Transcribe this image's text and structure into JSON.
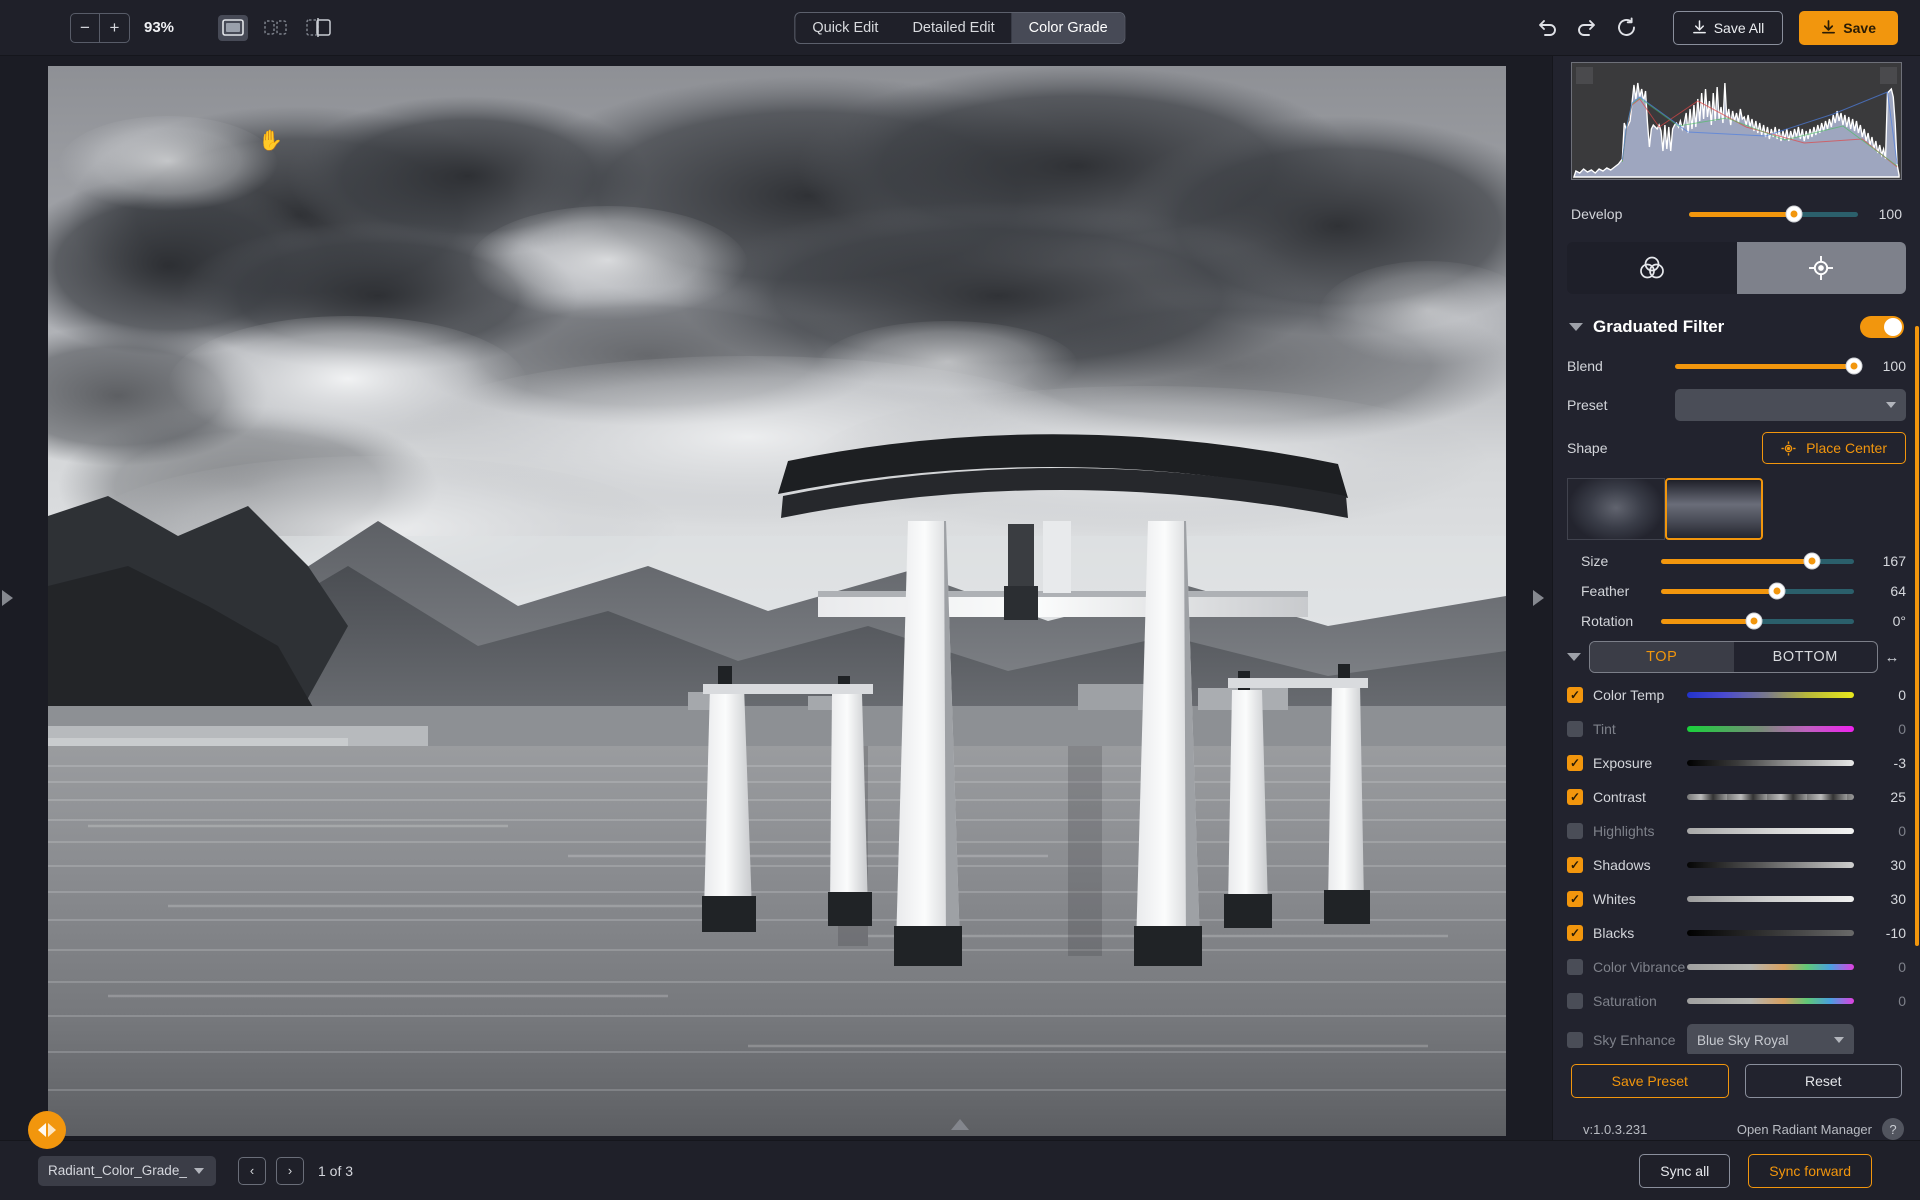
{
  "toolbar": {
    "zoom_out": "−",
    "zoom_in": "+",
    "zoom_level": "93%",
    "view_modes": [
      {
        "name": "single-view-icon",
        "active": true
      },
      {
        "name": "split-view-icon",
        "active": false
      },
      {
        "name": "compare-view-icon",
        "active": false
      }
    ],
    "tabs": [
      {
        "label": "Quick Edit",
        "active": false
      },
      {
        "label": "Detailed Edit",
        "active": false
      },
      {
        "label": "Color Grade",
        "active": true
      }
    ],
    "undo_label": "Undo",
    "redo_label": "Redo",
    "reset_label": "Reset",
    "save_all_label": "Save All",
    "save_label": "Save"
  },
  "panel": {
    "develop": {
      "label": "Develop",
      "value": "100",
      "percent": 62
    },
    "tool_tabs": [
      {
        "name": "color-wheels-icon",
        "active": false
      },
      {
        "name": "target-adjust-icon",
        "active": true
      }
    ],
    "section": {
      "title": "Graduated Filter",
      "enabled": true
    },
    "blend": {
      "label": "Blend",
      "value": "100",
      "percent": 100
    },
    "preset": {
      "label": "Preset",
      "value": "",
      "placeholder": ""
    },
    "shape": {
      "label": "Shape",
      "button": "Place Center"
    },
    "shape_tiles": [
      {
        "name": "radial-shape-tile",
        "selected": false
      },
      {
        "name": "graduated-shape-tile",
        "selected": true
      }
    ],
    "geometry": [
      {
        "label": "Size",
        "value": "167",
        "percent": 78
      },
      {
        "label": "Feather",
        "value": "64",
        "percent": 60
      },
      {
        "label": "Rotation",
        "value": "0°",
        "percent": 48
      }
    ],
    "top_bottom": {
      "top": "TOP",
      "bottom": "BOTTOM",
      "active": "TOP"
    },
    "adjustments": [
      {
        "label": "Color Temp",
        "checked": true,
        "value": "0",
        "percent": 50,
        "grad": "temp"
      },
      {
        "label": "Tint",
        "checked": false,
        "value": "0",
        "percent": 50,
        "grad": "tint",
        "hide_knob": true
      },
      {
        "label": "Exposure",
        "checked": true,
        "value": "-3",
        "percent": 47,
        "grad": "gray"
      },
      {
        "label": "Contrast",
        "checked": true,
        "value": "25",
        "percent": 60,
        "grad": "contrast"
      },
      {
        "label": "Highlights",
        "checked": false,
        "value": "0",
        "percent": 50,
        "grad": "light",
        "hide_knob": true
      },
      {
        "label": "Shadows",
        "checked": true,
        "value": "30",
        "percent": 62,
        "grad": "gray"
      },
      {
        "label": "Whites",
        "checked": true,
        "value": "30",
        "percent": 62,
        "grad": "light"
      },
      {
        "label": "Blacks",
        "checked": true,
        "value": "-10",
        "percent": 45,
        "grad": "dark"
      },
      {
        "label": "Color Vibrance",
        "checked": false,
        "value": "0",
        "percent": 50,
        "grad": "vibrance",
        "hide_knob": true
      },
      {
        "label": "Saturation",
        "checked": false,
        "value": "0",
        "percent": 50,
        "grad": "vibrance",
        "hide_knob": true
      }
    ],
    "sky_enhance": {
      "label": "Sky Enhance",
      "checked": false,
      "value": "Blue Sky Royal"
    },
    "save_preset_label": "Save Preset",
    "reset_label": "Reset",
    "version": "v:1.0.3.231",
    "manager_label": "Open Radiant Manager",
    "help_label": "?"
  },
  "bottombar": {
    "file_name": "Radiant_Color_Grade_",
    "prev_label": "‹",
    "next_label": "›",
    "counter": "1 of 3",
    "sync_all_label": "Sync all",
    "sync_forward_label": "Sync forward"
  },
  "canvas": {
    "left_expander": "expand-left-panel",
    "right_expander": "expand-right-panel",
    "compare_badge": "before-after-compare"
  },
  "colors": {
    "accent": "#f2960d",
    "panel_bg": "#22232e",
    "bar_bg": "#1f2029",
    "app_bg": "#1b1c24"
  }
}
